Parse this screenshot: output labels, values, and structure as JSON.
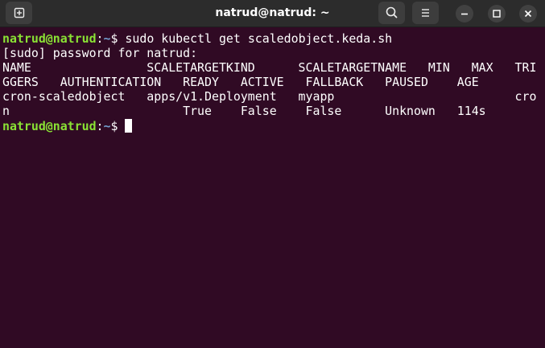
{
  "window": {
    "title": "natrud@natrud: ~"
  },
  "icons": {
    "new_tab": "new-tab-icon",
    "search": "search-icon",
    "menu": "hamburger-menu-icon",
    "minimize": "minimize-icon",
    "maximize": "maximize-icon",
    "close": "close-icon"
  },
  "colors": {
    "terminal_background": "#300a24",
    "prompt_user": "#8ae234",
    "prompt_path": "#729fcf",
    "text": "#ffffff",
    "headerbar": "#2c2c2c"
  },
  "terminal": {
    "prompt1": {
      "user_host": "natrud@natrud",
      "separator": ":",
      "path": "~",
      "symbol": "$",
      "command": " sudo kubectl get scaledobject.keda.sh"
    },
    "output": [
      "[sudo] password for natrud:",
      "NAME                SCALETARGETKIND      SCALETARGETNAME   MIN   MAX   TRI",
      "GGERS   AUTHENTICATION   READY   ACTIVE   FALLBACK   PAUSED    AGE",
      "cron-scaledobject   apps/v1.Deployment   myapp                         cro",
      "n                        True    False    False      Unknown   114s"
    ],
    "prompt2": {
      "user_host": "natrud@natrud",
      "separator": ":",
      "path": "~",
      "symbol": "$"
    }
  }
}
